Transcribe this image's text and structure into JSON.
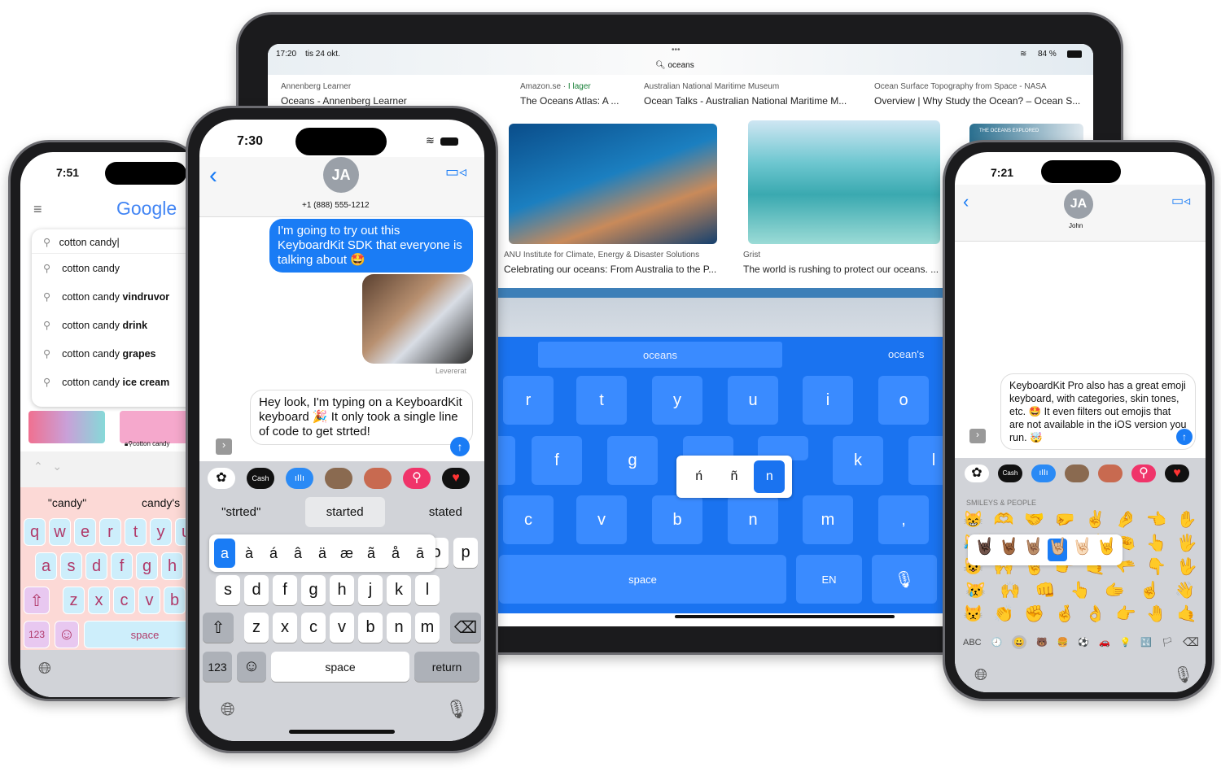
{
  "ipad": {
    "status": {
      "time": "17:20",
      "date": "tis 24 okt.",
      "battery": "84 %",
      "url": "oceans"
    },
    "top_results": [
      {
        "source": "Annenberg Learner",
        "title": "Oceans - Annenberg Learner"
      },
      {
        "source": "Amazon.se · ",
        "badge": "I lager",
        "title": "The Oceans Atlas: A ..."
      },
      {
        "source": "Australian National Maritime Museum",
        "title": "Ocean Talks - Australian National Maritime M..."
      },
      {
        "source": "Ocean Surface Topography from Space - NASA",
        "title": "Overview | Why Study the Ocean? – Ocean S..."
      }
    ],
    "image_results": [
      {
        "source": "ANU Institute for Climate, Energy & Disaster Solutions",
        "title": "Celebrating our oceans: From Australia to the P..."
      },
      {
        "source": "Grist",
        "title": "The world is rushing to protect our oceans. ..."
      }
    ],
    "thumb_caption": "THE OCEANS EXPLORED",
    "keyboard": {
      "suggestions": [
        "oceans",
        "ocean's"
      ],
      "row1": [
        "r",
        "t",
        "y",
        "u",
        "i",
        "o"
      ],
      "row2": [
        "f",
        "g",
        "k",
        "l"
      ],
      "row3": [
        "c",
        "v",
        "b",
        "n",
        "m",
        ","
      ],
      "space": "space",
      "lang": "EN",
      "callout": [
        "ń",
        "ñ",
        "n"
      ],
      "color": "#1a73f0"
    }
  },
  "left_phone": {
    "time": "7:51",
    "logo": "Google",
    "query": "cotton candy",
    "suggestions": [
      {
        "base": "cotton candy",
        "bold": ""
      },
      {
        "base": "cotton candy ",
        "bold": "vindruvor"
      },
      {
        "base": "cotton candy ",
        "bold": "drink"
      },
      {
        "base": "cotton candy ",
        "bold": "grapes"
      },
      {
        "base": "cotton candy ",
        "bold": "ice cream"
      }
    ],
    "url": "cotton candy",
    "keyboard": {
      "suggestions": [
        "\"candy\"",
        "candy's"
      ],
      "row1": [
        "q",
        "w",
        "e",
        "r",
        "t",
        "y",
        "u"
      ],
      "row2": [
        "a",
        "s",
        "d",
        "f",
        "g",
        "h"
      ],
      "row3": [
        "z",
        "x",
        "c",
        "v",
        "b"
      ],
      "numbers": "123",
      "space": "space",
      "bg": "#fcd9d6",
      "key_color": "#cdeefb"
    }
  },
  "mid_phone": {
    "time": "7:30",
    "avatar": "JA",
    "contact": "+1 (888) 555-1212",
    "sent_message": "I'm going to try out this KeyboardKit SDK that everyone is talking about 🤩",
    "delivered": "Levererat",
    "draft": "Hey look, I'm typing on a KeyboardKit keyboard 🎉 It only took a single line of code to get strted!",
    "apps": [
      "Photos",
      "Cash",
      "Audio",
      "Memoji",
      "Stickers",
      "Search",
      "Fitness"
    ],
    "cash_label": "Cash",
    "keyboard": {
      "suggestions": [
        "\"strted\"",
        "started",
        "stated"
      ],
      "callout": [
        "a",
        "à",
        "á",
        "â",
        "ä",
        "æ",
        "ã",
        "å",
        "ā"
      ],
      "row1_right": [
        "o",
        "p"
      ],
      "row2": [
        "s",
        "d",
        "f",
        "g",
        "h",
        "j",
        "k",
        "l"
      ],
      "row3": [
        "z",
        "x",
        "c",
        "v",
        "b",
        "n",
        "m"
      ],
      "numbers": "123",
      "space": "space",
      "return": "return"
    }
  },
  "right_phone": {
    "time": "7:21",
    "avatar": "JA",
    "contact": "John",
    "draft": "KeyboardKit Pro also has a great emoji keyboard, with categories, skin tones, etc. 🤩 It even filters out emojis that are not available in the iOS version you run. 🤯",
    "cash_label": "Cash",
    "category": "SMILEYS & PEOPLE",
    "emoji_rows": [
      "😸🫶🤝🤛✌️🤌👈✋",
      "😹🤲👍👊🤞🤏👆🖐",
      "😺🙌🤘👉🤙🫳👇🖖",
      "😿🙌👊👆🫱☝️👋",
      "😾👏✊🤞👌👉🤚🤙"
    ],
    "skin_tones": [
      "🤘🏿",
      "🤘🏾",
      "🤘🏽",
      "🤘🏼",
      "🤘🏻",
      "🤘"
    ],
    "abc": "ABC",
    "categories": [
      "🕘",
      "😀",
      "🐻",
      "🍔",
      "⚽",
      "🚗",
      "💡",
      "🔣",
      "🏳"
    ]
  }
}
